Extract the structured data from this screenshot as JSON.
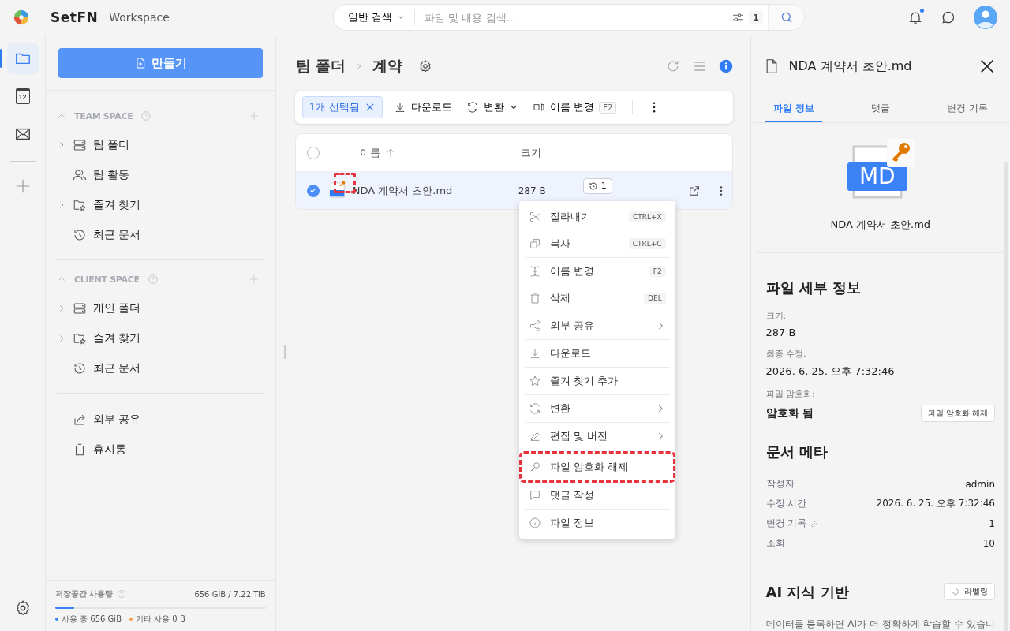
{
  "app": {
    "brand": "SetFN",
    "product": "Workspace"
  },
  "search": {
    "scope": "일반 검색",
    "placeholder": "파일 및 내용 검색...",
    "filter_count": "1"
  },
  "header": {
    "notification_unread": true
  },
  "rail": {
    "items": [
      {
        "kind": "folder",
        "selected": true
      },
      {
        "kind": "calendar",
        "selected": false,
        "day": "12"
      },
      {
        "kind": "mail",
        "selected": false
      }
    ]
  },
  "sidebar": {
    "create_button": "만들기",
    "sections": [
      {
        "title": "TEAM SPACE",
        "expanded": true,
        "items": [
          {
            "label": "팀 폴더",
            "kind": "drive",
            "expandable": true
          },
          {
            "label": "팀 활동",
            "kind": "people",
            "expandable": false
          },
          {
            "label": "즐겨 찾기",
            "kind": "star-folder",
            "expandable": true
          },
          {
            "label": "최근 문서",
            "kind": "history",
            "expandable": false
          }
        ]
      },
      {
        "title": "CLIENT SPACE",
        "expanded": true,
        "items": [
          {
            "label": "개인 폴더",
            "kind": "drive",
            "expandable": true
          },
          {
            "label": "즐겨 찾기",
            "kind": "star-folder",
            "expandable": true
          },
          {
            "label": "최근 문서",
            "kind": "history",
            "expandable": false
          }
        ]
      }
    ],
    "extra_items": [
      {
        "label": "외부 공유",
        "kind": "share"
      },
      {
        "label": "휴지통",
        "kind": "trash"
      }
    ],
    "storage": {
      "title": "저장공간 사용량",
      "total": "656 GiB / 7.22 TiB",
      "level": 0.09,
      "legend": [
        {
          "label": "사용 중 656 GiB",
          "color": "#3b82f6"
        },
        {
          "label": "기타 사용 0 B",
          "color": "#f59e42"
        }
      ]
    }
  },
  "breadcrumb": [
    "팀 폴더",
    "계약"
  ],
  "toolbar": {
    "selection": "1개 선택됨",
    "actions": [
      {
        "label": "다운로드",
        "kind": "download"
      },
      {
        "label": "변환",
        "kind": "convert",
        "dropdown": true
      },
      {
        "label": "이름 변경",
        "kind": "rename",
        "shortcut": "F2"
      }
    ]
  },
  "table": {
    "columns": [
      "이름",
      "크기"
    ],
    "sort_ascending": true,
    "all_selected": false,
    "rows": [
      {
        "name": "NDA 계약서 초안.md",
        "size": "287 B",
        "versions": "1",
        "selected": true,
        "encrypted": true,
        "highlighted": true
      }
    ]
  },
  "context_menu": {
    "groups": [
      [
        {
          "label": "잘라내기",
          "kind": "cut",
          "shortcut": "CTRL+X"
        },
        {
          "label": "복사",
          "kind": "copy",
          "shortcut": "CTRL+C"
        }
      ],
      [
        {
          "label": "이름 변경",
          "kind": "rename",
          "shortcut": "F2"
        },
        {
          "label": "삭제",
          "kind": "trash",
          "shortcut": "DEL"
        }
      ],
      [
        {
          "label": "외부 공유",
          "kind": "share-nodes",
          "submenu": true
        }
      ],
      [
        {
          "label": "다운로드",
          "kind": "download"
        }
      ],
      [
        {
          "label": "즐겨 찾기 추가",
          "kind": "star"
        }
      ],
      [
        {
          "label": "변환",
          "kind": "convert",
          "submenu": true
        }
      ],
      [
        {
          "label": "편집 및 버전",
          "kind": "edit",
          "submenu": true
        }
      ],
      [
        {
          "label": "파일 암호화 해제",
          "kind": "key",
          "highlighted": true
        },
        {
          "label": "댓글 작성",
          "kind": "comment"
        }
      ],
      [
        {
          "label": "파일 정보",
          "kind": "info"
        }
      ]
    ]
  },
  "details": {
    "title": "NDA 계약서 초안.md",
    "tabs": [
      {
        "label": "파일 정보",
        "selected": true
      },
      {
        "label": "댓글",
        "selected": false
      },
      {
        "label": "변경 기록",
        "selected": false
      }
    ],
    "preview": {
      "type": "MD",
      "encrypted": true,
      "name": "NDA 계약서 초안.md"
    },
    "file_details": {
      "heading": "파일 세부 정보",
      "fields": [
        {
          "label": "크기:",
          "value": "287 B"
        },
        {
          "label": "최종 수정:",
          "value": "2026. 6. 25. 오후 7:32:46"
        }
      ],
      "encryption": {
        "label": "파일 암호화:",
        "value": "암호화 됨",
        "button": "파일 암호화 해제"
      }
    },
    "meta": {
      "heading": "문서 메타",
      "rows": [
        {
          "label": "작성자",
          "value": "admin",
          "link": false
        },
        {
          "label": "수정 시간",
          "value": "2026. 6. 25. 오후 7:32:46",
          "link": false
        },
        {
          "label": "변경 기록",
          "value": "1",
          "link": true
        },
        {
          "label": "조회",
          "value": "10",
          "link": false
        }
      ]
    },
    "ai": {
      "heading": "AI 지식 기반",
      "button": "라벨링",
      "description": "데이터를 등록하면 AI가 더 정확하게 학습할 수 있습니"
    }
  }
}
